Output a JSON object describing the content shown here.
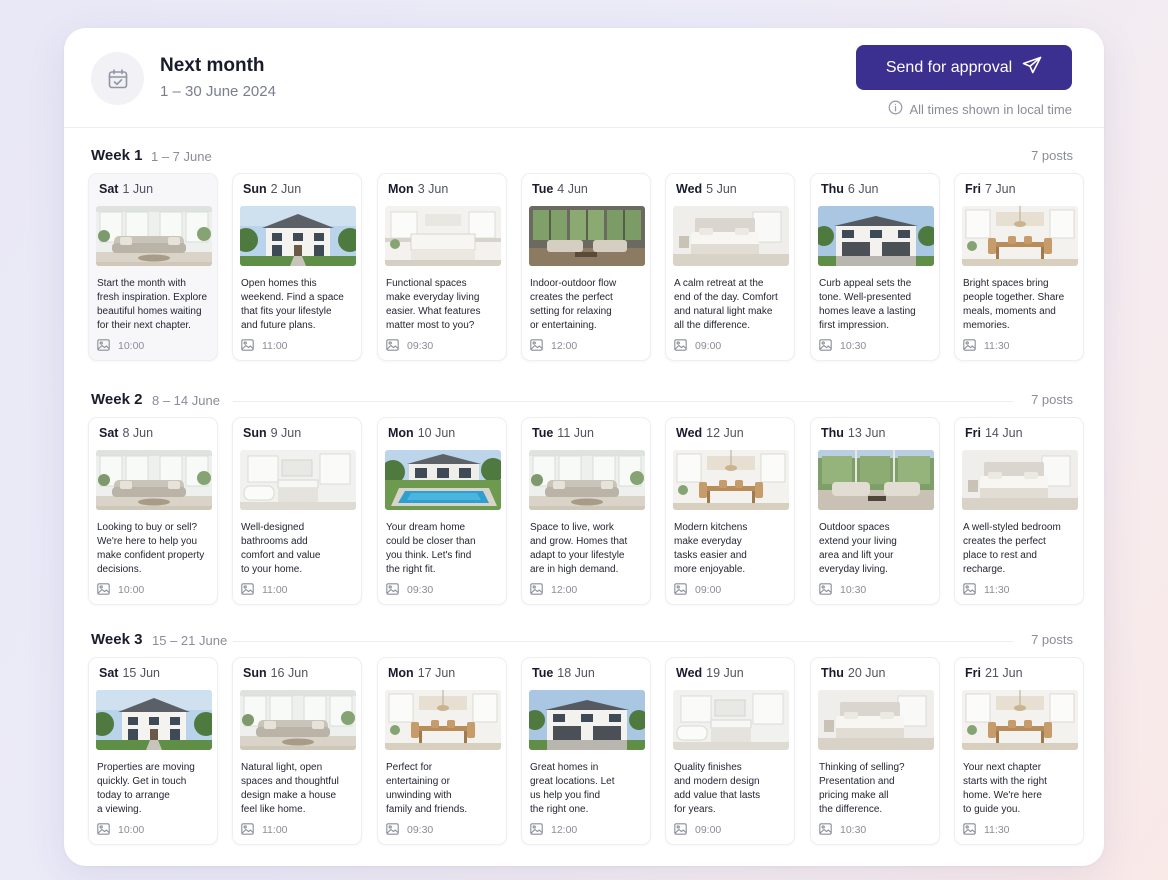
{
  "header": {
    "title": "Next month",
    "subtitle": "1 – 30 June 2024",
    "send_label": "Send for approval",
    "timezone_note": "All times shown in local time"
  },
  "colors": {
    "accent": "#3b2f8f",
    "muted": "#8a8d99",
    "text": "#1a1c2c"
  },
  "weeks": [
    {
      "label": "Week 1",
      "range": "1 – 7 June",
      "count": "7 posts",
      "days": [
        {
          "dow": "Sat",
          "date": "1 Jun",
          "image": "living-room",
          "caption": [
            "Start the month with",
            "fresh inspiration. Explore",
            "beautiful homes waiting",
            "for their next chapter."
          ],
          "time": "10:00"
        },
        {
          "dow": "Sun",
          "date": "2 Jun",
          "image": "house-exterior",
          "caption": [
            "Open homes this",
            "weekend. Find a space",
            "that fits your lifestyle",
            "and future plans."
          ],
          "time": "11:00"
        },
        {
          "dow": "Mon",
          "date": "3 Jun",
          "image": "kitchen",
          "caption": [
            "Functional spaces",
            "make everyday living",
            "easier. What features",
            "matter most to you?"
          ],
          "time": "09:30"
        },
        {
          "dow": "Tue",
          "date": "4 Jun",
          "image": "sunroom",
          "caption": [
            "Indoor-outdoor flow",
            "creates the perfect",
            "setting for relaxing",
            "or entertaining."
          ],
          "time": "12:00"
        },
        {
          "dow": "Wed",
          "date": "5 Jun",
          "image": "bedroom",
          "caption": [
            "A calm retreat at the",
            "end of the day. Comfort",
            "and natural light make",
            "all the difference."
          ],
          "time": "09:00"
        },
        {
          "dow": "Thu",
          "date": "6 Jun",
          "image": "house-garage",
          "caption": [
            "Curb appeal sets the",
            "tone. Well-presented",
            "homes leave a lasting",
            "first impression."
          ],
          "time": "10:30"
        },
        {
          "dow": "Fri",
          "date": "7 Jun",
          "image": "dining",
          "caption": [
            "Bright spaces bring",
            "people together. Share",
            "meals, moments and",
            "memories."
          ],
          "time": "11:30"
        }
      ]
    },
    {
      "label": "Week 2",
      "range": "8 – 14 June",
      "count": "7 posts",
      "days": [
        {
          "dow": "Sat",
          "date": "8 Jun",
          "image": "living-room",
          "caption": [
            "Looking to buy or sell?",
            "We're here to help you",
            "make confident property",
            "decisions."
          ],
          "time": "10:00"
        },
        {
          "dow": "Sun",
          "date": "9 Jun",
          "image": "bathroom",
          "caption": [
            "Well-designed",
            "bathrooms add",
            "comfort and value",
            "to your home."
          ],
          "time": "11:00"
        },
        {
          "dow": "Mon",
          "date": "10 Jun",
          "image": "pool",
          "caption": [
            "Your dream home",
            "could be closer than",
            "you think. Let's find",
            "the right fit."
          ],
          "time": "09:30"
        },
        {
          "dow": "Tue",
          "date": "11 Jun",
          "image": "living-room",
          "caption": [
            "Space to live, work",
            "and grow. Homes that",
            "adapt to your lifestyle",
            "are in high demand."
          ],
          "time": "12:00"
        },
        {
          "dow": "Wed",
          "date": "12 Jun",
          "image": "dining",
          "caption": [
            "Modern kitchens",
            "make everyday",
            "tasks easier and",
            "more enjoyable."
          ],
          "time": "09:00"
        },
        {
          "dow": "Thu",
          "date": "13 Jun",
          "image": "patio",
          "caption": [
            "Outdoor spaces",
            "extend your living",
            "area and lift your",
            "everyday living."
          ],
          "time": "10:30"
        },
        {
          "dow": "Fri",
          "date": "14 Jun",
          "image": "bedroom",
          "caption": [
            "A well-styled bedroom",
            "creates the perfect",
            "place to rest and",
            "recharge."
          ],
          "time": "11:30"
        }
      ]
    },
    {
      "label": "Week 3",
      "range": "15 – 21 June",
      "count": "7 posts",
      "days": [
        {
          "dow": "Sat",
          "date": "15 Jun",
          "image": "house-exterior",
          "caption": [
            "Properties are moving",
            "quickly. Get in touch",
            "today to arrange",
            "a viewing."
          ],
          "time": "10:00"
        },
        {
          "dow": "Sun",
          "date": "16 Jun",
          "image": "living-room",
          "caption": [
            "Natural light, open",
            "spaces and thoughtful",
            "design make a house",
            "feel like home."
          ],
          "time": "11:00"
        },
        {
          "dow": "Mon",
          "date": "17 Jun",
          "image": "dining",
          "caption": [
            "Perfect for",
            "entertaining or",
            "unwinding with",
            "family and friends."
          ],
          "time": "09:30"
        },
        {
          "dow": "Tue",
          "date": "18 Jun",
          "image": "house-garage",
          "caption": [
            "Great homes in",
            "great locations. Let",
            "us help you find",
            "the right one."
          ],
          "time": "12:00"
        },
        {
          "dow": "Wed",
          "date": "19 Jun",
          "image": "bathroom",
          "caption": [
            "Quality finishes",
            "and modern design",
            "add value that lasts",
            "for years."
          ],
          "time": "09:00"
        },
        {
          "dow": "Thu",
          "date": "20 Jun",
          "image": "bedroom",
          "caption": [
            "Thinking of selling?",
            "Presentation and",
            "pricing make all",
            "the difference."
          ],
          "time": "10:30"
        },
        {
          "dow": "Fri",
          "date": "21 Jun",
          "image": "dining",
          "caption": [
            "Your next chapter",
            "starts with the right",
            "home. We're here",
            "to guide you."
          ],
          "time": "11:30"
        }
      ]
    }
  ]
}
